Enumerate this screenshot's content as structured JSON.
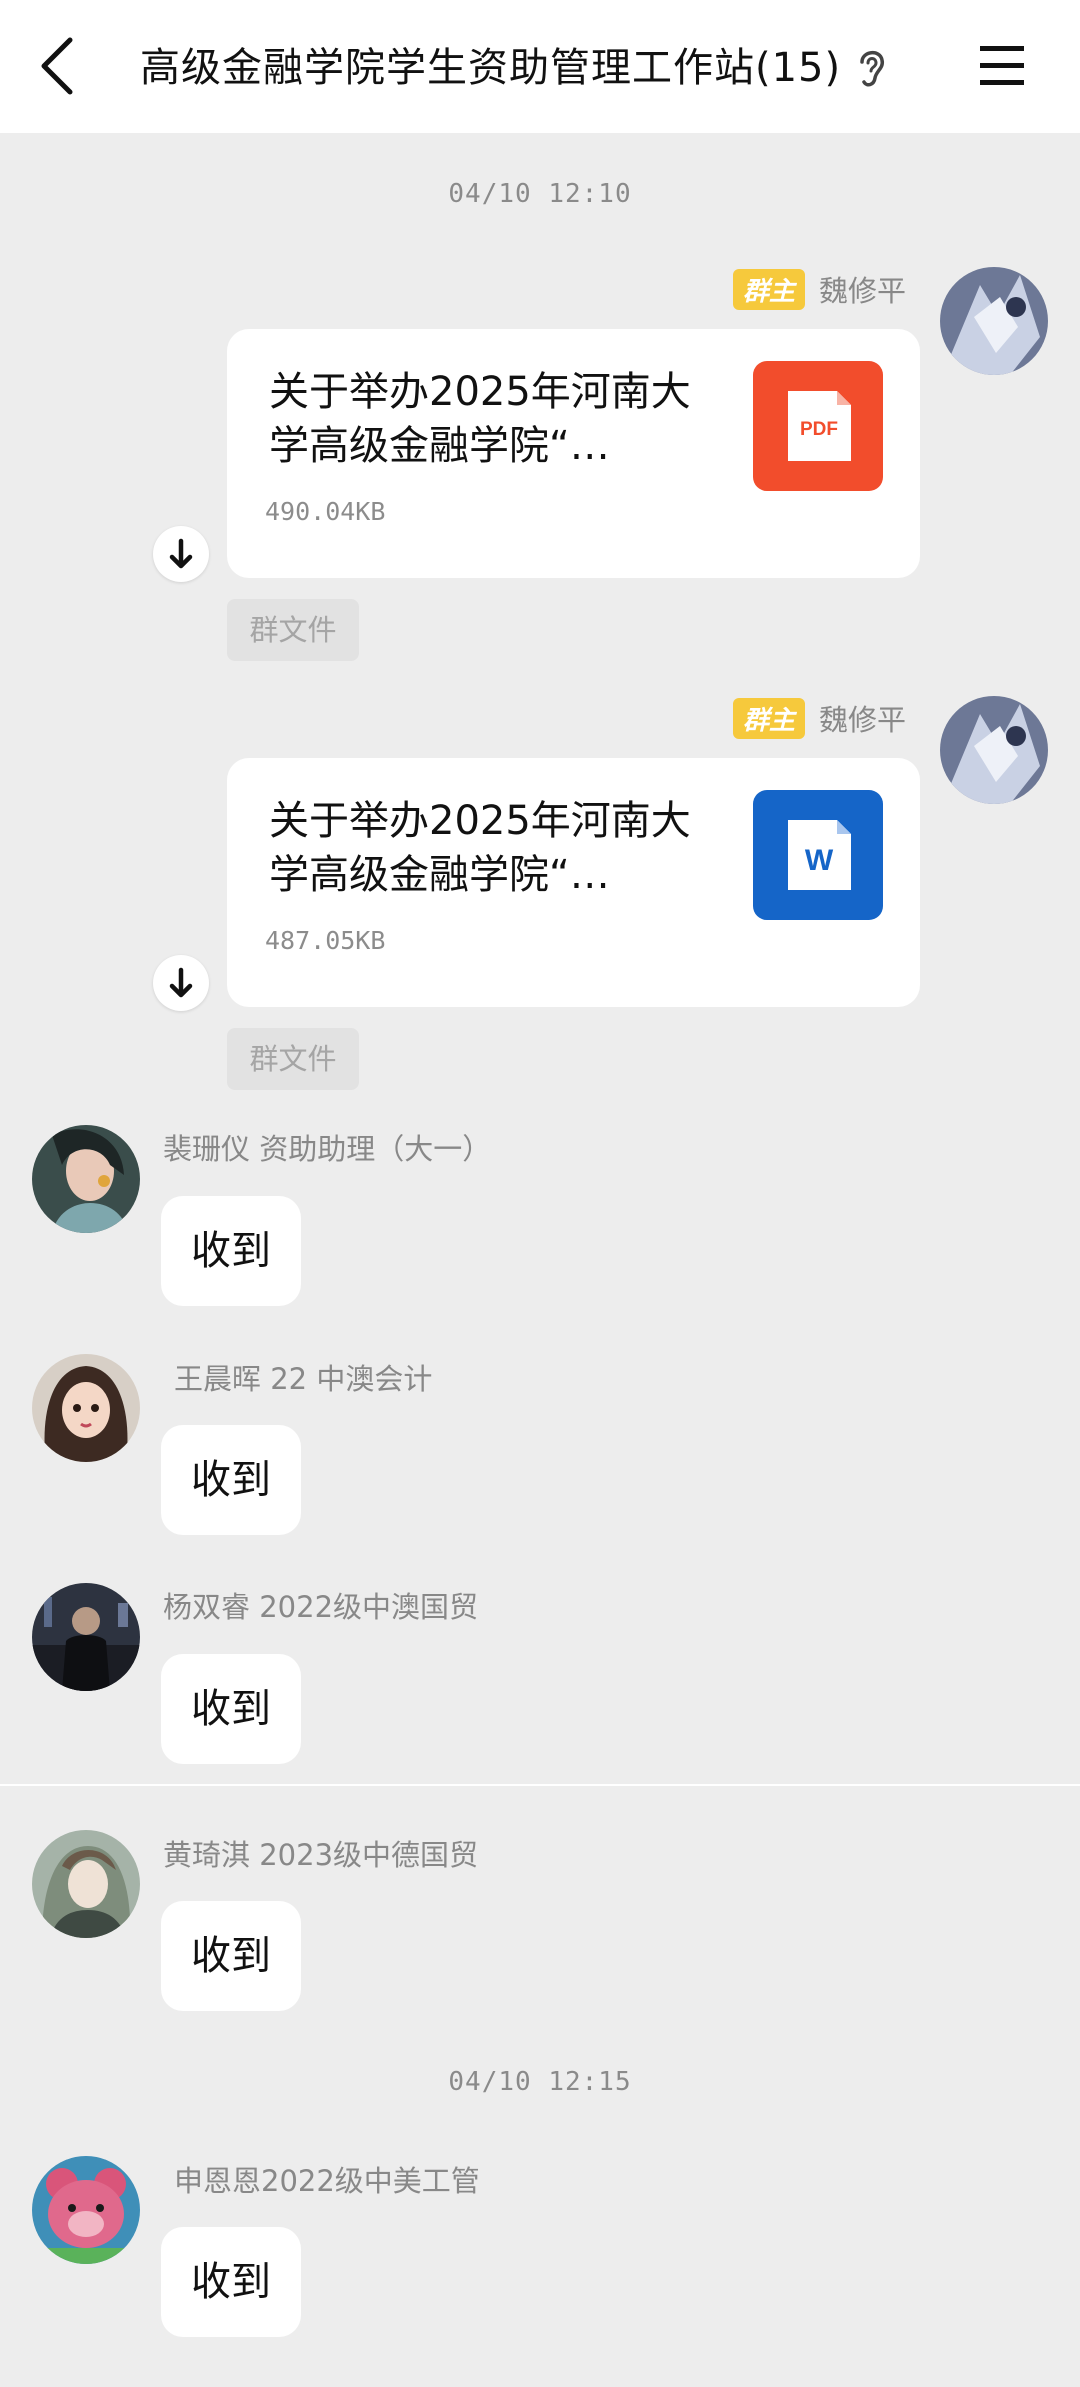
{
  "header": {
    "title": "高级金融学院学生资助管理工作站(15)",
    "back_icon": "chevron-left-icon",
    "ear_icon": "ear-icon",
    "menu_icon": "hamburger-menu-icon"
  },
  "timestamps": [
    "04/10  12:10",
    "04/10  12:15"
  ],
  "file_messages": [
    {
      "sender": "魏修平",
      "role_badge": "群主",
      "file_name": "关于举办2025年河南大学高级金融学院“…",
      "file_size": "490.04KB",
      "file_type": "PDF",
      "file_icon_color": "#f24d2c",
      "tag": "群文件"
    },
    {
      "sender": "魏修平",
      "role_badge": "群主",
      "file_name": "关于举办2025年河南大学高级金融学院“…",
      "file_size": "487.05KB",
      "file_type": "W",
      "file_icon_color": "#1565c8",
      "tag": "群文件"
    }
  ],
  "text_messages": [
    {
      "sender": "裴珊仪  资助助理（大一）",
      "text": "收到"
    },
    {
      "sender": "王晨晖  22  中澳会计",
      "text": "收到"
    },
    {
      "sender": "杨双睿  2022级中澳国贸",
      "text": "收到"
    },
    {
      "sender": "黄琦淇  2023级中德国贸",
      "text": "收到"
    },
    {
      "sender": "申恩恩2022级中美工管",
      "text": "收到"
    }
  ],
  "colors": {
    "background": "#ededed",
    "badge": "#f6c93c",
    "pdf": "#f24d2c",
    "word": "#1565c8"
  }
}
